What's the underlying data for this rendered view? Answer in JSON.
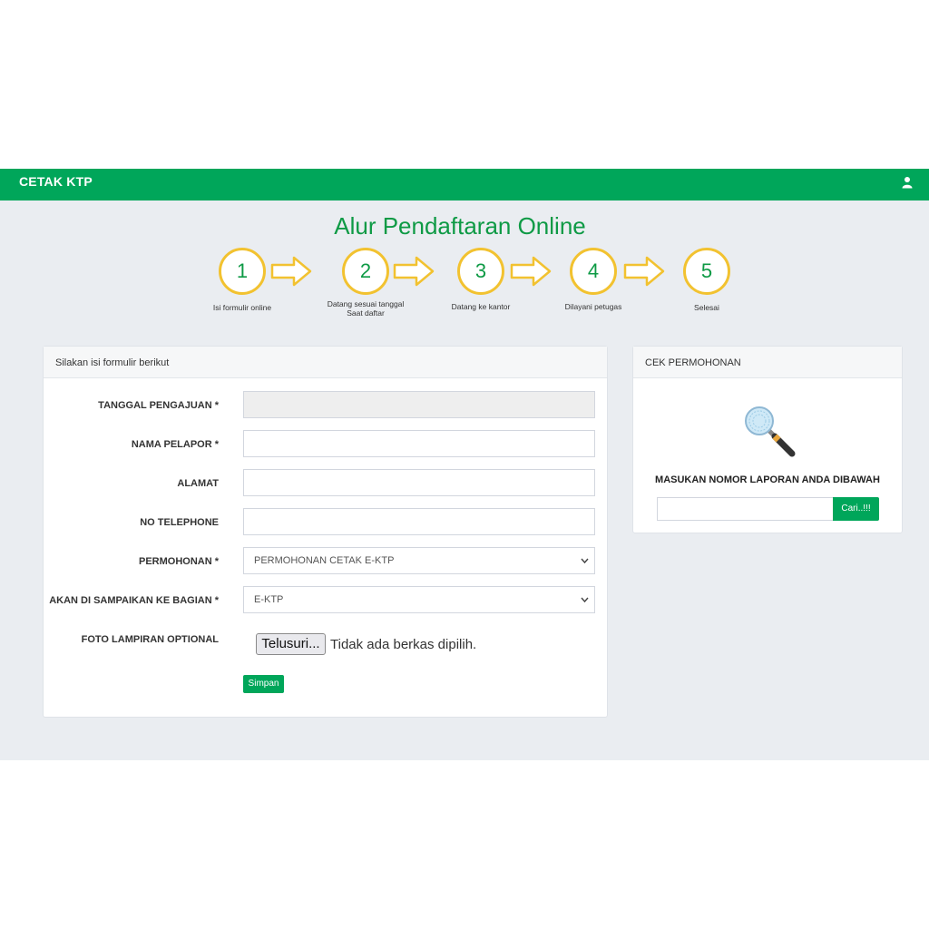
{
  "navbar": {
    "brand": "CETAK KTP",
    "user_icon": "user-icon"
  },
  "flow": {
    "title": "Alur Pendaftaran Online",
    "steps": [
      {
        "number": "1",
        "label": "Isi formulir online"
      },
      {
        "number": "2",
        "label_line1": "Datang sesuai tanggal",
        "label_line2": "Saat daftar"
      },
      {
        "number": "3",
        "label": "Datang ke kantor"
      },
      {
        "number": "4",
        "label": "Dilayani petugas"
      },
      {
        "number": "5",
        "label": "Selesai"
      }
    ],
    "accent_color": "#f2c230",
    "number_color": "#0e9a45"
  },
  "form_panel": {
    "heading": "Silakan isi formulir berikut",
    "fields": {
      "tanggal_label": "TANGGAL PENGAJUAN *",
      "tanggal_value": "",
      "nama_label": "NAMA PELAPOR *",
      "nama_value": "",
      "alamat_label": "ALAMAT",
      "alamat_value": "",
      "telephone_label": "NO TELEPHONE",
      "telephone_value": "",
      "permohonan_label": "PERMOHONAN *",
      "permohonan_value": "PERMOHONAN CETAK E-KTP",
      "bagian_label": "AKAN DI SAMPAIKAN KE BAGIAN *",
      "bagian_value": "E-KTP",
      "foto_label": "FOTO LAMPIRAN OPTIONAL",
      "file_button": "Telusuri...",
      "file_status": "Tidak ada berkas dipilih."
    },
    "submit_label": "Simpan"
  },
  "cek_panel": {
    "heading": "CEK PERMOHONAN",
    "icon": "magnifier-icon",
    "instruction": "MASUKAN NOMOR LAPORAN ANDA DIBAWAH",
    "input_value": "",
    "search_button": "Cari..!!!"
  },
  "colors": {
    "brand_green": "#00a65a",
    "page_bg": "#eaedf1"
  }
}
